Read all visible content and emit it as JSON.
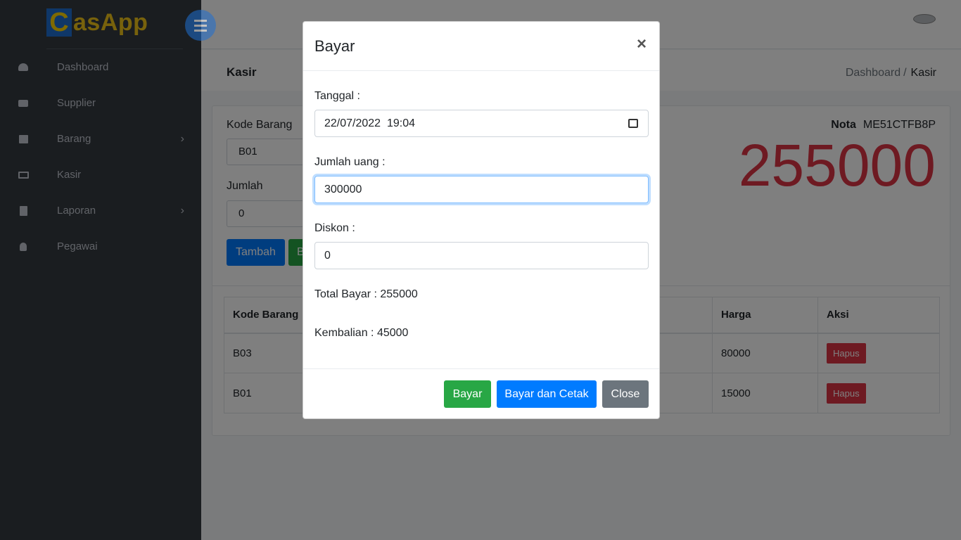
{
  "app": {
    "logo_letter": "C",
    "logo_text": "asApp"
  },
  "sidebar": {
    "items": [
      {
        "label": "Dashboard",
        "icon": "tachometer-icon",
        "has_submenu": false
      },
      {
        "label": "Supplier",
        "icon": "truck-icon",
        "has_submenu": false
      },
      {
        "label": "Barang",
        "icon": "archive-icon",
        "has_submenu": true
      },
      {
        "label": "Kasir",
        "icon": "desktop-icon",
        "has_submenu": false
      },
      {
        "label": "Laporan",
        "icon": "file-icon",
        "has_submenu": true
      },
      {
        "label": "Pegawai",
        "icon": "user-icon",
        "has_submenu": false
      }
    ]
  },
  "header": {
    "page_title": "Kasir",
    "breadcrumb": [
      "Dashboard",
      "Kasir"
    ],
    "breadcrumb_sep": "/"
  },
  "kasir_form": {
    "kode_barang_label": "Kode Barang",
    "kode_barang_value": "B01",
    "jumlah_label": "Jumlah",
    "jumlah_value": "0",
    "tambah_button": "Tambah",
    "second_button_partial": "B"
  },
  "nota": {
    "label": "Nota",
    "value": "ME51CTFB8P"
  },
  "total_display": "255000",
  "cart_table": {
    "headers": [
      "Kode Barang",
      "Harga",
      "Aksi"
    ],
    "rows": [
      {
        "kode": "B03",
        "harga": "80000",
        "aksi": "Hapus"
      },
      {
        "kode": "B01",
        "harga": "15000",
        "aksi": "Hapus"
      }
    ]
  },
  "modal": {
    "title": "Bayar",
    "close_symbol": "×",
    "tanggal_label": "Tanggal :",
    "tanggal_value": "22/07/2022  19:04",
    "jumlah_uang_label": "Jumlah uang :",
    "jumlah_uang_value": "300000",
    "diskon_label": "Diskon :",
    "diskon_value": "0",
    "total_bayar": "Total Bayar : 255000",
    "kembalian": "Kembalian : 45000",
    "buttons": {
      "bayar": "Bayar",
      "bayar_cetak": "Bayar dan Cetak",
      "close": "Close"
    }
  },
  "colors": {
    "primary": "#007bff",
    "success": "#28a745",
    "danger": "#dc3545",
    "secondary": "#6c757d",
    "sidebar": "#343a40"
  }
}
